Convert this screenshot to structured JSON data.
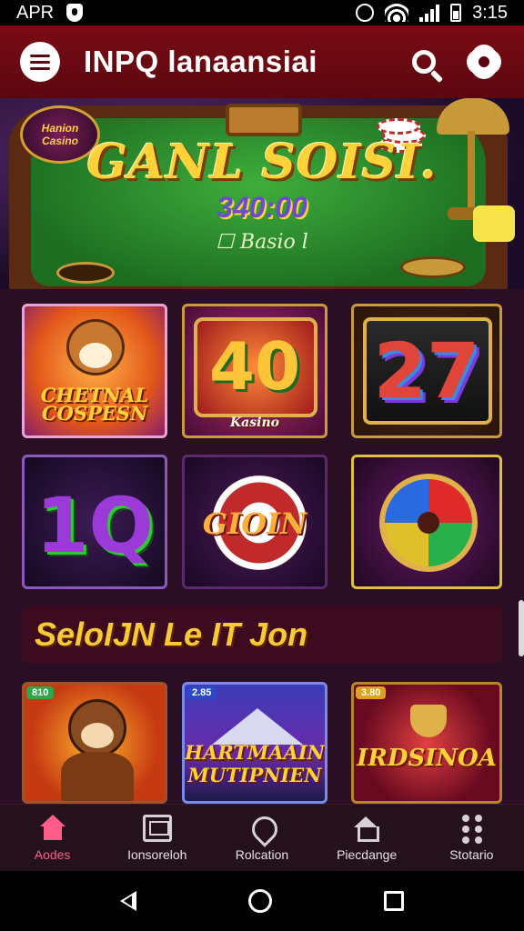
{
  "status_bar": {
    "left_text": "APR",
    "time": "3:15"
  },
  "app_bar": {
    "title": "INPQ lanaansiai"
  },
  "banner": {
    "logo_text": "Hanion\nCasino",
    "title": "GANL SOISI.",
    "amount": "340:00",
    "subtitle": "☐ Basio l"
  },
  "games_row1": [
    {
      "label": "CHETNAL\nCOSPESN"
    },
    {
      "label": "40",
      "sub": "Kasino"
    },
    {
      "label": "27"
    }
  ],
  "games_row2": [
    {
      "label": "1Q"
    },
    {
      "label": "GIOIN"
    },
    {
      "label": ""
    }
  ],
  "section": {
    "title": "SeloIJN  Le IT Jon"
  },
  "games_row3": [
    {
      "badge": "810",
      "label": "",
      "badge_color": "#2ea84a"
    },
    {
      "badge": "2.85",
      "label": "HARTMAAIN\nMUTIPNIEN",
      "badge_color": "#2a4ac8"
    },
    {
      "badge": "3.80",
      "label": "IRDSINOA",
      "badge_color": "#e0a020"
    }
  ],
  "bottom_nav": [
    {
      "label": "Aodes",
      "icon": "home-icon"
    },
    {
      "label": "Ionsoreloh",
      "icon": "box-icon"
    },
    {
      "label": "Rolcation",
      "icon": "location-icon"
    },
    {
      "label": "Piecdange",
      "icon": "house-icon"
    },
    {
      "label": "Stotario",
      "icon": "grid-icon"
    }
  ]
}
